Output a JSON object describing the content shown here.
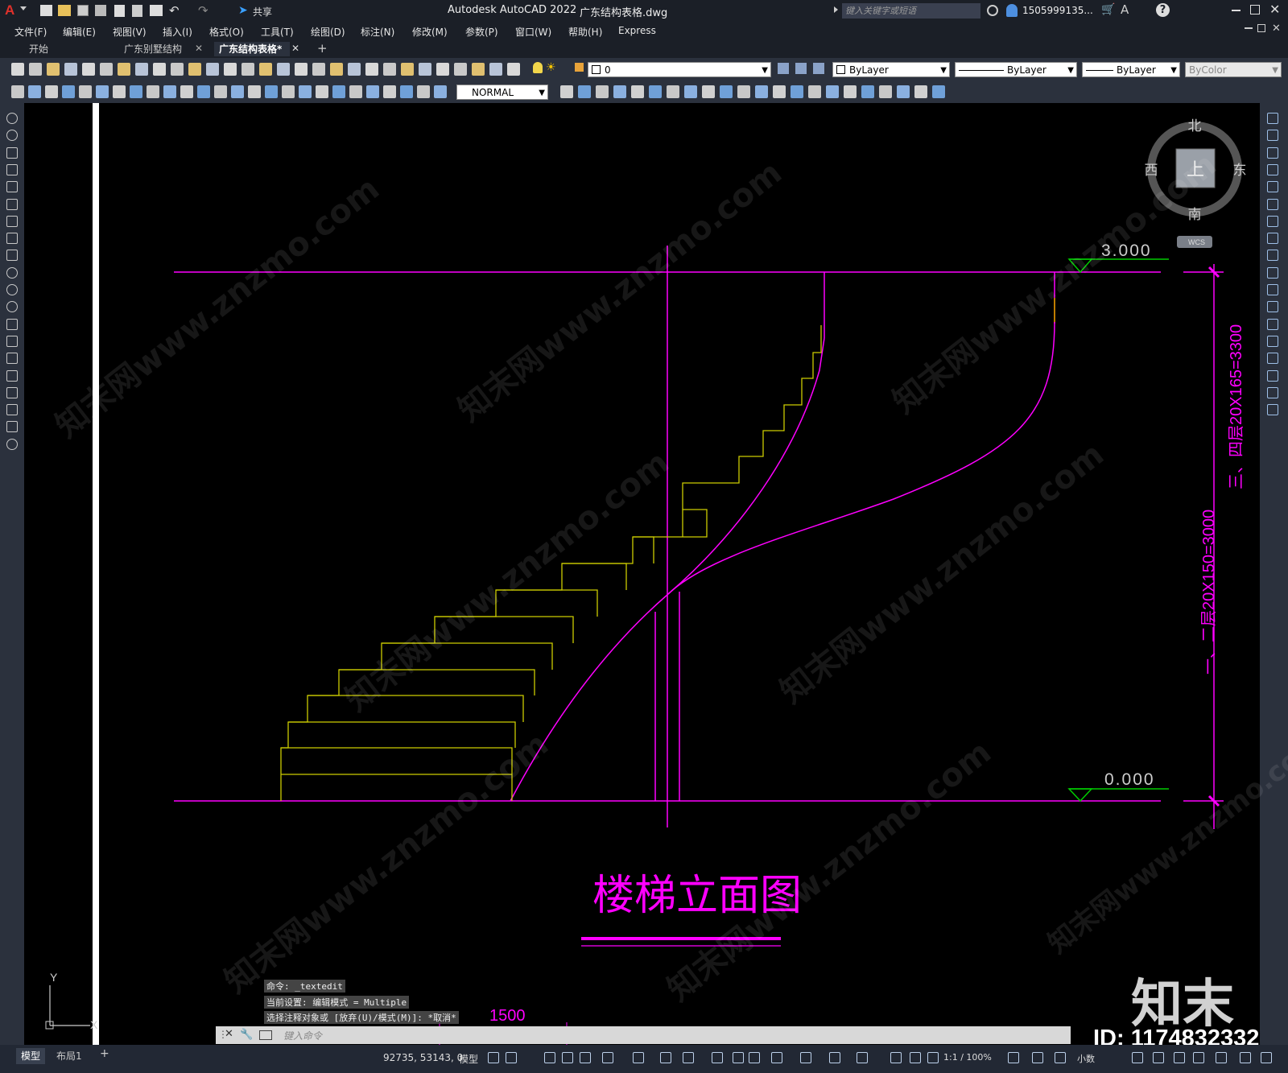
{
  "title_bar": {
    "app_logo": "A",
    "share_label": "共享",
    "title": "Autodesk AutoCAD 2022",
    "filename": "广东结构表格.dwg",
    "search_placeholder": "键入关键字或短语",
    "user": "1505999135...",
    "help_icon": "?"
  },
  "menu": {
    "items": [
      "文件(F)",
      "编辑(E)",
      "视图(V)",
      "插入(I)",
      "格式(O)",
      "工具(T)",
      "绘图(D)",
      "标注(N)",
      "修改(M)",
      "参数(P)",
      "窗口(W)",
      "帮助(H)",
      "Express"
    ]
  },
  "tabs": {
    "items": [
      "开始",
      "广东别墅结构",
      "广东结构表格*"
    ],
    "add_label": "+"
  },
  "toolbar": {
    "layer_value": "0",
    "color_value": "ByLayer",
    "linetype_value": "ByLayer",
    "lineweight_value": "ByLayer",
    "plotstyle_value": "ByColor",
    "dimstyle_value": "NORMAL"
  },
  "viewcube": {
    "north": "北",
    "south": "南",
    "east": "东",
    "west": "西",
    "top": "上",
    "wcs": "WCS"
  },
  "drawing": {
    "level_top": "3.000",
    "level_bottom": "0.000",
    "dim_right_outer": "三、四层20X165=3300",
    "dim_right_inner": "一、二层20X150=3000",
    "title": "楼梯立面图",
    "dim_bottom": "1500",
    "ucs_y": "Y",
    "ucs_x": "X"
  },
  "colors": {
    "magenta": "#ff00ff",
    "yellow": "#cccc00",
    "orange": "#ffa500",
    "canvas": "#000000"
  },
  "command": {
    "history": [
      "命令: _textedit",
      "当前设置: 编辑模式 = Multiple",
      "选择注释对象或 [放弃(U)/模式(M)]: *取消*"
    ],
    "placeholder": "键入命令"
  },
  "layout_tabs": {
    "model": "模型",
    "layout1": "布局1",
    "add": "+"
  },
  "status": {
    "coords": "92735, 53143, 0",
    "space": "模型",
    "scale": "1:1 / 100%",
    "units": "小数"
  },
  "watermark": {
    "brand": "知末",
    "id": "ID: 1174832332",
    "site": "知末网www.znzmo.com"
  }
}
